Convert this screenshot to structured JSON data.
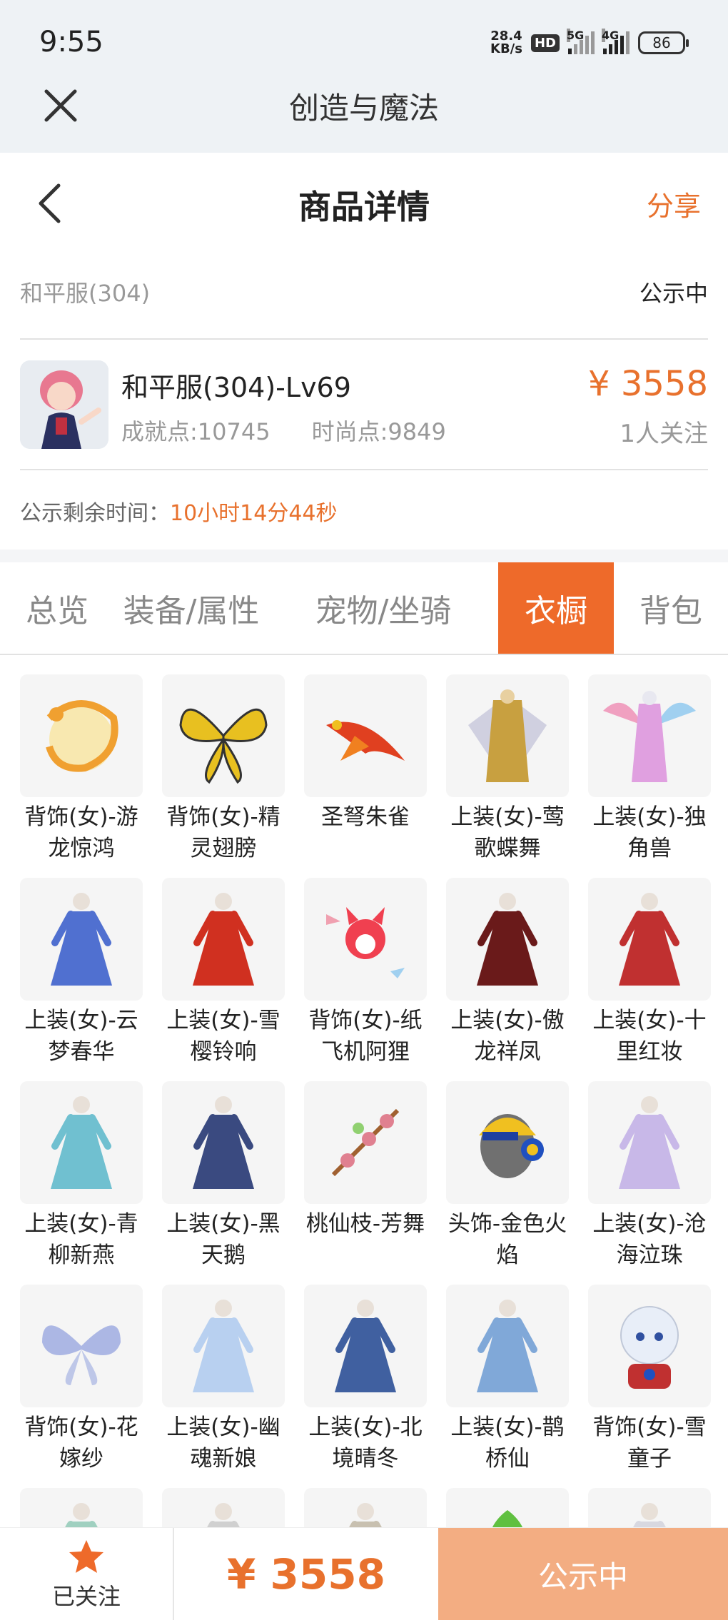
{
  "status_bar": {
    "time": "9:55",
    "net_speed_value": "28.4",
    "net_speed_unit": "KB/s",
    "hd": "HD",
    "sig1_label": "5G",
    "sig2_label": "4G",
    "battery": "86"
  },
  "app_bar": {
    "title": "创造与魔法"
  },
  "header": {
    "title": "商品详情",
    "share": "分享"
  },
  "info": {
    "server": "和平服(304)",
    "status": "公示中",
    "char_name": "和平服(304)-Lv69",
    "achievement": "成就点:10745",
    "fashion": "时尚点:9849",
    "price": "¥ 3558",
    "followers": "1人关注",
    "remain_label": "公示剩余时间：",
    "remain_value": "10小时14分44秒"
  },
  "tabs": [
    {
      "label": "总览",
      "active": false
    },
    {
      "label": "装备/属性",
      "active": false
    },
    {
      "label": "宠物/坐骑",
      "active": false
    },
    {
      "label": "衣橱",
      "active": true
    },
    {
      "label": "背包",
      "active": false
    }
  ],
  "wardrobe": [
    {
      "label": "背饰(女)-游龙惊鸿",
      "icon": "dragon-ornament-icon",
      "color": "#f0a030"
    },
    {
      "label": "背饰(女)-精灵翅膀",
      "icon": "butterfly-wings-icon",
      "color": "#e8c020"
    },
    {
      "label": "圣弩朱雀",
      "icon": "phoenix-icon",
      "color": "#e04020"
    },
    {
      "label": "上装(女)-莺歌蝶舞",
      "icon": "armor-outfit-icon",
      "color": "#c8a040"
    },
    {
      "label": "上装(女)-独角兽",
      "icon": "unicorn-outfit-icon",
      "color": "#e0a0e0"
    },
    {
      "label": "上装(女)-云梦春华",
      "icon": "dress-outfit-icon",
      "color": "#5070d0"
    },
    {
      "label": "上装(女)-雪樱铃响",
      "icon": "dress-outfit-icon",
      "color": "#d03020"
    },
    {
      "label": "背饰(女)-纸飞机阿狸",
      "icon": "fox-ornament-icon",
      "color": "#f04050"
    },
    {
      "label": "上装(女)-傲龙祥凤",
      "icon": "dress-outfit-icon",
      "color": "#6a1a1a"
    },
    {
      "label": "上装(女)-十里红妆",
      "icon": "dress-outfit-icon",
      "color": "#c03030"
    },
    {
      "label": "上装(女)-青柳新燕",
      "icon": "dress-outfit-icon",
      "color": "#70c0d0"
    },
    {
      "label": "上装(女)-黑天鹅",
      "icon": "dress-outfit-icon",
      "color": "#3a4a80"
    },
    {
      "label": "桃仙枝-芳舞",
      "icon": "peach-branch-icon",
      "color": "#e08090"
    },
    {
      "label": "头饰-金色火焰",
      "icon": "cap-headphones-icon",
      "color": "#f0c020"
    },
    {
      "label": "上装(女)-沧海泣珠",
      "icon": "dress-outfit-icon",
      "color": "#c8b8e8"
    },
    {
      "label": "背饰(女)-花嫁纱",
      "icon": "fairy-wings-icon",
      "color": "#9aa8e0"
    },
    {
      "label": "上装(女)-幽魂新娘",
      "icon": "dress-outfit-icon",
      "color": "#b8d0f0"
    },
    {
      "label": "上装(女)-北境晴冬",
      "icon": "dress-outfit-icon",
      "color": "#4060a0"
    },
    {
      "label": "上装(女)-鹊桥仙",
      "icon": "dress-outfit-icon",
      "color": "#80a8d8"
    },
    {
      "label": "背饰(女)-雪童子",
      "icon": "snow-child-icon",
      "color": "#e8eef8"
    },
    {
      "label": "",
      "icon": "dress-outfit-icon",
      "color": "#a0d0c0"
    },
    {
      "label": "",
      "icon": "dress-outfit-icon",
      "color": "#d0d0d0"
    },
    {
      "label": "",
      "icon": "dress-outfit-icon",
      "color": "#c8c0b0"
    },
    {
      "label": "",
      "icon": "leaf-icon",
      "color": "#60c040"
    },
    {
      "label": "",
      "icon": "dress-outfit-icon",
      "color": "#d8d8e0"
    }
  ],
  "bottom": {
    "follow_label": "已关注",
    "price": "¥ 3558",
    "status_button": "公示中"
  }
}
